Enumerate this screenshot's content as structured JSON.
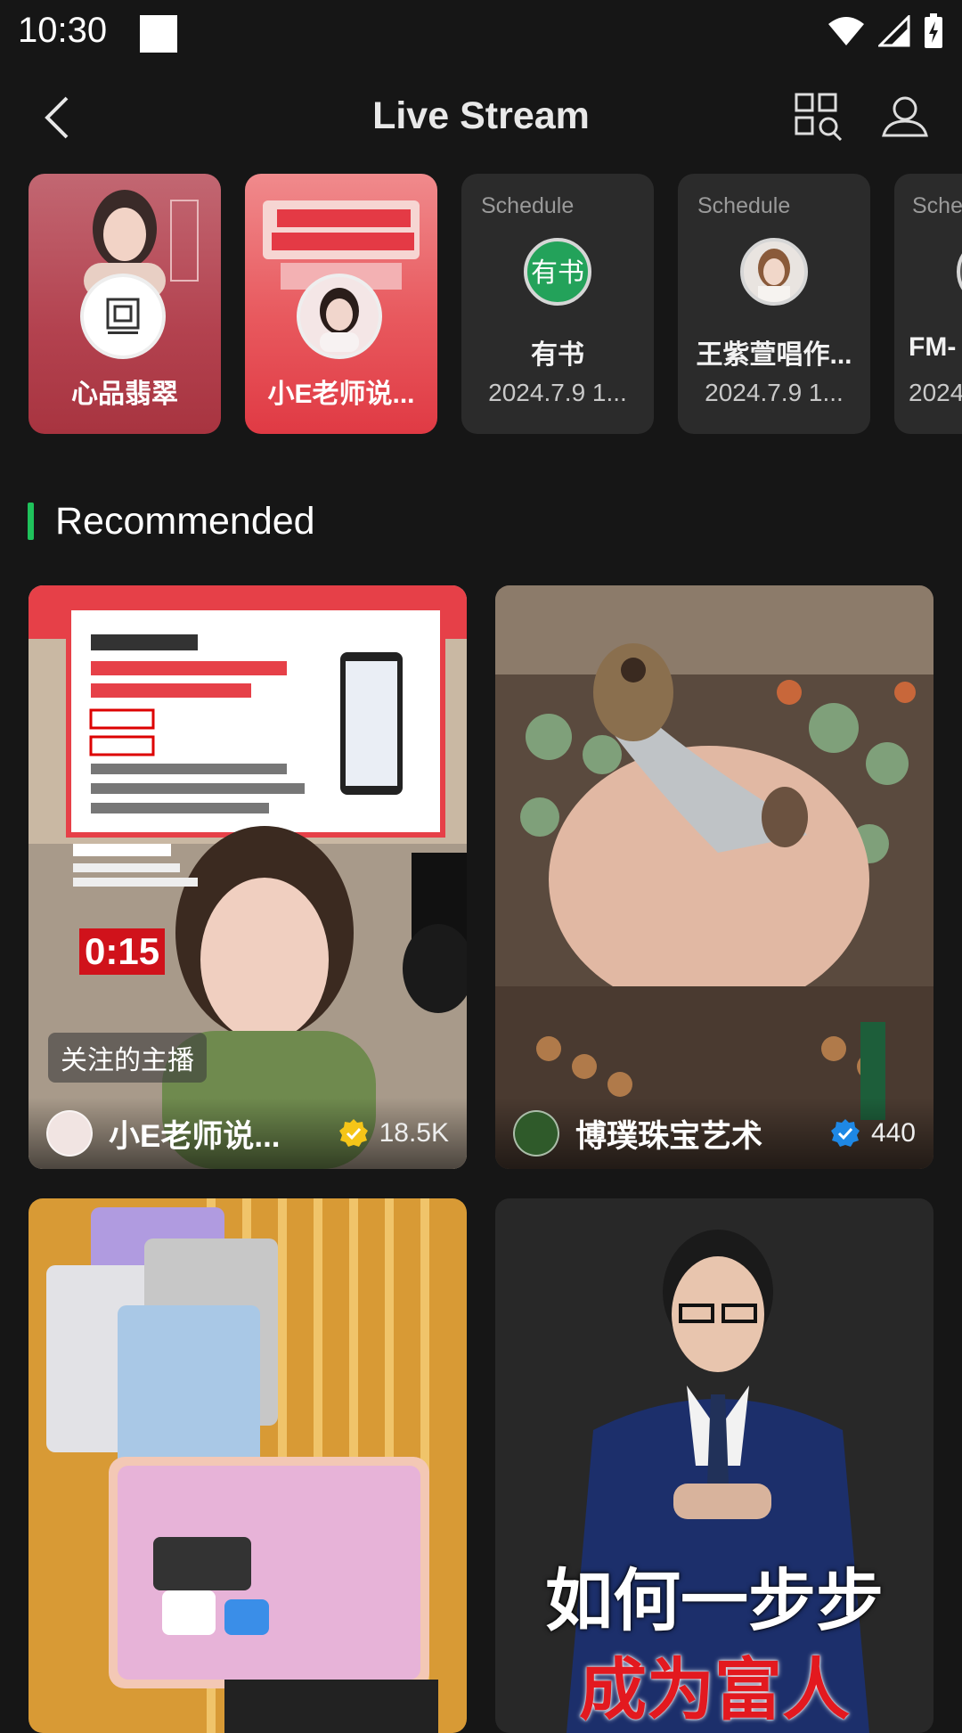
{
  "status_bar": {
    "time": "10:30"
  },
  "header": {
    "title": "Live Stream"
  },
  "stories": [
    {
      "type": "live",
      "name": "心品翡翠"
    },
    {
      "type": "live",
      "name": "小E老师说..."
    },
    {
      "type": "schedule",
      "label": "Schedule",
      "name": "有书",
      "time": "2024.7.9 1..."
    },
    {
      "type": "schedule",
      "label": "Schedule",
      "name": "王紫萱唱作...",
      "time": "2024.7.9 1..."
    },
    {
      "type": "schedule",
      "label": "Sche",
      "name": "FM-",
      "time": "2024"
    }
  ],
  "section": {
    "title": "Recommended"
  },
  "feed": [
    {
      "host": "小E老师说...",
      "viewers": "18.5K",
      "tag": "关注的主播",
      "timer": "0:15",
      "verified_color": "#f5c518"
    },
    {
      "host": "博璞珠宝艺术",
      "viewers": "440",
      "verified_color": "#1e88e5"
    },
    {
      "poster_text": []
    },
    {
      "poster_line1": "如何一步步",
      "poster_line2": "成为富人"
    }
  ],
  "colors": {
    "accent": "#1fc25b",
    "background": "#161616"
  }
}
